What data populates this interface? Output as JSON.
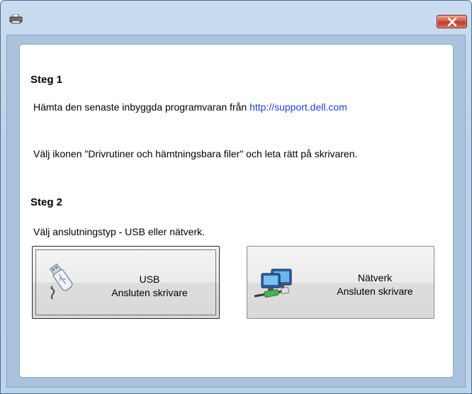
{
  "window": {
    "icons": {
      "app": "printer-icon",
      "close": "close-icon"
    }
  },
  "step1": {
    "heading": "Steg 1",
    "download_text": "Hämta den senaste inbyggda programvaran från",
    "link": "http://support.dell.com",
    "select_text": "Välj ikonen \"Drivrutiner och hämtningsbara filer\" och leta rätt på skrivaren."
  },
  "step2": {
    "heading": "Steg 2",
    "text": "Välj anslutningstyp - USB eller nätverk."
  },
  "buttons": {
    "usb": {
      "line1": "USB",
      "line2": "Ansluten skrivare",
      "icon": "usb-drive-icon"
    },
    "network": {
      "line1": "Nätverk",
      "line2": "Ansluten skrivare",
      "icon": "network-computers-icon"
    }
  }
}
